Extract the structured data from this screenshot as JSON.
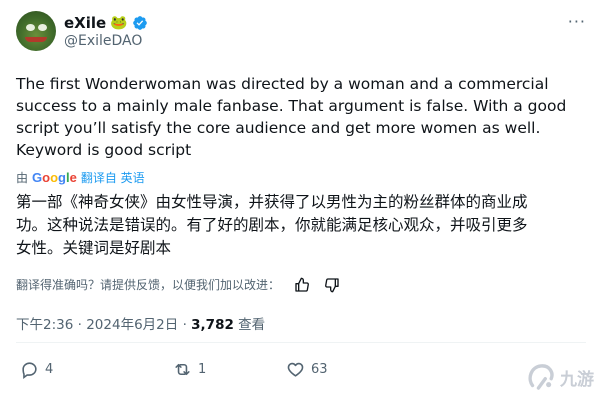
{
  "user": {
    "display_name": "eXile",
    "badge_emoji": "🐸",
    "handle": "@ExileDAO"
  },
  "tweet": {
    "text": "The first Wonderwoman was directed by a woman and a commercial\nsuccess to a mainly male fanbase. That argument is false. With a good\nscript you’ll satisfy the core audience and get more women as well.\nKeyword is good script",
    "translated_by_prefix": "由",
    "translator": "Google",
    "translate_label": "翻译自 英语",
    "translated_text": "第一部《神奇女侠》由女性导演，并获得了以男性为主的粉丝群体的商业成\n功。这种说法是错误的。有了好的剧本，你就能满足核心观众，并吸引更多\n女性。关键词是好剧本",
    "feedback_prompt": "翻译得准确吗？请提供反馈，以便我们加以改进："
  },
  "meta": {
    "time": "下午2:36",
    "separator": "·",
    "date": "2024年6月2日",
    "views": "3,782",
    "views_label": "查看"
  },
  "actions": {
    "replies": "4",
    "retweets": "1",
    "likes": "63"
  },
  "watermark": {
    "text": "九游"
  },
  "colors": {
    "accent": "#1d9bf0",
    "text": "#0f1419",
    "secondary": "#536471"
  },
  "icons": [
    "frog-emoji-icon",
    "verified-badge-icon",
    "more-icon",
    "thumbs-up-icon",
    "thumbs-down-icon",
    "reply-icon",
    "retweet-icon",
    "like-icon",
    "jiuyou-logo-icon"
  ]
}
